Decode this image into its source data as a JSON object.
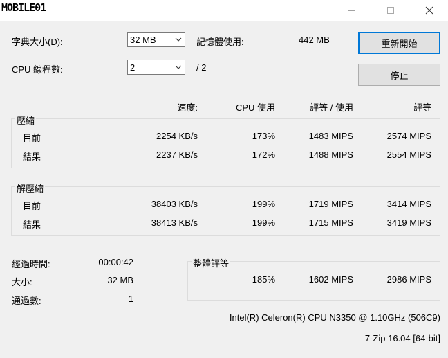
{
  "title": {
    "logo_text": "MOBILE01",
    "minimize_icon": "minimize-icon",
    "maximize_icon": "maximize-icon",
    "close_icon": "close-icon"
  },
  "settings": {
    "dict_label": "字典大小(D):",
    "dict_value": "32 MB",
    "threads_label": "CPU 線程數:",
    "threads_value": "2",
    "threads_total": "/ 2",
    "mem_label": "記憶體使用:",
    "mem_value": "442 MB"
  },
  "buttons": {
    "restart": "重新開始",
    "stop": "停止"
  },
  "columns": {
    "speed": "速度:",
    "cpu_usage": "CPU 使用",
    "rating_usage": "評等 / 使用",
    "rating": "評等"
  },
  "compress": {
    "label": "壓縮",
    "rows": [
      {
        "name": "目前",
        "speed": "2254 KB/s",
        "cpu": "173%",
        "rating_usage": "1483 MIPS",
        "rating": "2574 MIPS"
      },
      {
        "name": "結果",
        "speed": "2237 KB/s",
        "cpu": "172%",
        "rating_usage": "1488 MIPS",
        "rating": "2554 MIPS"
      }
    ]
  },
  "decompress": {
    "label": "解壓縮",
    "rows": [
      {
        "name": "目前",
        "speed": "38403 KB/s",
        "cpu": "199%",
        "rating_usage": "1719 MIPS",
        "rating": "3414 MIPS"
      },
      {
        "name": "結果",
        "speed": "38413 KB/s",
        "cpu": "199%",
        "rating_usage": "1715 MIPS",
        "rating": "3419 MIPS"
      }
    ]
  },
  "stats": {
    "elapsed_label": "經過時間:",
    "elapsed_value": "00:00:42",
    "size_label": "大小:",
    "size_value": "32 MB",
    "passes_label": "通過數:",
    "passes_value": "1"
  },
  "total": {
    "label": "整體評等",
    "cpu": "185%",
    "rating_usage": "1602 MIPS",
    "rating": "2986 MIPS"
  },
  "footer": {
    "cpu_name": "Intel(R) Celeron(R) CPU N3350 @ 1.10GHz (506C9)",
    "version": "7-Zip 16.04 [64-bit]"
  }
}
